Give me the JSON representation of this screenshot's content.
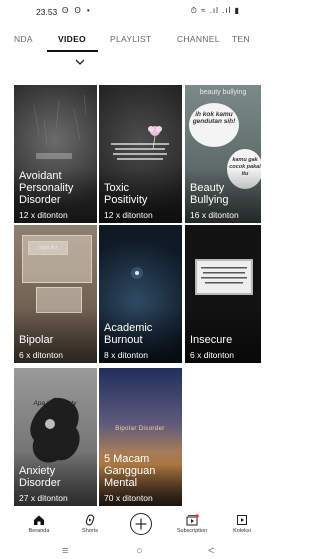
{
  "status_bar": {
    "time": "23.53",
    "notification_icons": "ʘ ʘ •",
    "system_icons": "⏱ ≈ .ıl .ıl ▮"
  },
  "tabs": [
    {
      "label": "NDA",
      "active": false
    },
    {
      "label": "VIDEO",
      "active": true
    },
    {
      "label": "PLAYLIST",
      "active": false
    },
    {
      "label": "CHANNEL",
      "active": false
    },
    {
      "label": "TEN",
      "active": false
    }
  ],
  "playlists": [
    {
      "title_lines": [
        "Avoidant",
        "Personality",
        "Disorder"
      ],
      "count": "12 x ditonton",
      "art_text": "",
      "art_color": "#3a3a3a"
    },
    {
      "title_lines": [
        "Toxic",
        "Positivity"
      ],
      "count": "12 x ditonton",
      "art_text": "",
      "art_color": "#262626"
    },
    {
      "title_lines": [
        "Beauty",
        "Bullying"
      ],
      "count": "16 x ditonton",
      "art_text": "beauty bullying",
      "bubble_1": "ih kok kamu gendutan sih!",
      "bubble_2": "kamu gak cocok pakai itu",
      "art_color": "#6b7876"
    },
    {
      "title_lines": [
        "Bipolar"
      ],
      "count": "6 x ditonton",
      "art_text": "apa itu",
      "art_color": "#7a6a5a"
    },
    {
      "title_lines": [
        "Academic",
        "Burnout"
      ],
      "count": "8 x ditonton",
      "art_text": "",
      "art_color": "#1b2c3c"
    },
    {
      "title_lines": [
        "Insecure"
      ],
      "count": "6 x ditonton",
      "art_text": "",
      "art_color": "#121212"
    },
    {
      "title_lines": [
        "Anxiety",
        "Disorder"
      ],
      "count": "27 x ditonton",
      "art_text": "Apa itu Anxiety Disorder?",
      "art_color": "#7c7c7c"
    },
    {
      "title_lines": [
        "5 Macam",
        "Gangguan",
        "Mental"
      ],
      "count": "70 x ditonton",
      "art_text": "Bipolar Disorder",
      "art_color": "#4a4a6a"
    }
  ],
  "bottom_nav": [
    {
      "label": "Beranda",
      "icon": "home-icon"
    },
    {
      "label": "Shorts",
      "icon": "shorts-icon"
    },
    {
      "label": "",
      "icon": "create-icon"
    },
    {
      "label": "Subscription",
      "icon": "subscriptions-icon"
    },
    {
      "label": "Koleksi",
      "icon": "library-icon"
    }
  ],
  "system_nav": {
    "recents": "≡",
    "home": "○",
    "back": "<"
  },
  "colors": {
    "notification_dot": "#e53935",
    "tab_active": "#111111",
    "tab_inactive": "#666666"
  }
}
